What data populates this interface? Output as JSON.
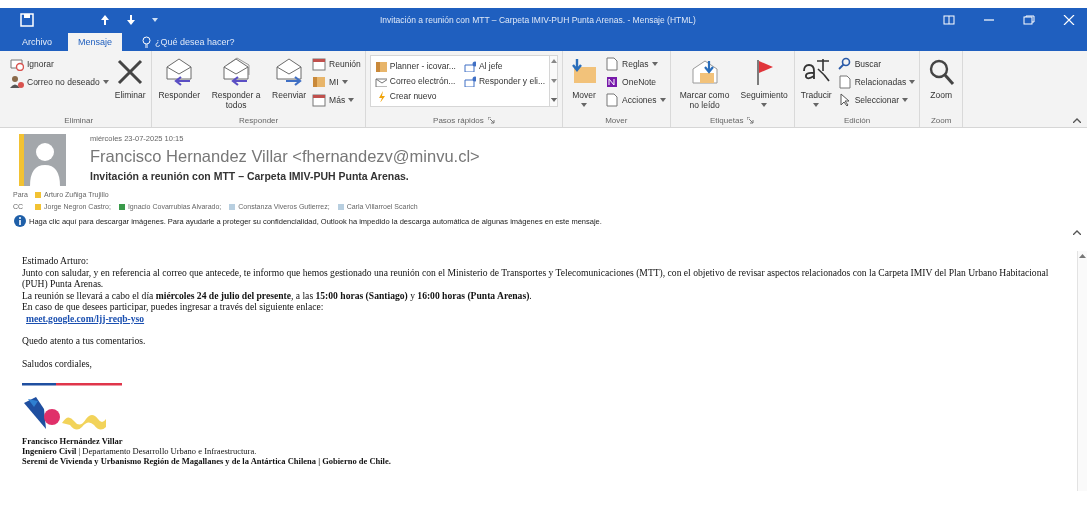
{
  "window": {
    "title": "Invitación a reunión con MTT – Carpeta IMIV-PUH Punta Arenas. - Mensaje (HTML)"
  },
  "tabs": [
    {
      "label": "Archivo",
      "selected": false
    },
    {
      "label": "Mensaje",
      "selected": true
    }
  ],
  "tell_me": {
    "placeholder": "¿Qué desea hacer?"
  },
  "ribbon": [
    {
      "label": "Eliminar",
      "launcher": false,
      "items": [
        {
          "kind": "small",
          "label": "Ignorar",
          "caret": false
        },
        {
          "kind": "small",
          "label": "Correo no deseado",
          "caret": true
        },
        {
          "kind": "large",
          "label": "Eliminar",
          "caret": false
        }
      ]
    },
    {
      "label": "Responder",
      "launcher": false,
      "items": [
        {
          "kind": "large",
          "label": "Responder",
          "caret": false
        },
        {
          "kind": "large",
          "label": "Responder a todos",
          "caret": false
        },
        {
          "kind": "large",
          "label": "Reenviar",
          "caret": false
        },
        {
          "kind": "small",
          "label": "Reunión",
          "caret": false
        },
        {
          "kind": "small",
          "label": "MI",
          "caret": true
        },
        {
          "kind": "small",
          "label": "Más",
          "caret": true
        }
      ]
    },
    {
      "label": "Pasos rápidos",
      "launcher": true,
      "items": [
        {
          "kind": "gallery",
          "label": "Planner - icovar..."
        },
        {
          "kind": "gallery",
          "label": "Correo electrón..."
        },
        {
          "kind": "gallery",
          "label": "Crear nuevo"
        },
        {
          "kind": "gallery",
          "label": "Al jefe"
        },
        {
          "kind": "gallery",
          "label": "Responder y eli..."
        }
      ]
    },
    {
      "label": "Mover",
      "launcher": false,
      "items": [
        {
          "kind": "large",
          "label": "Mover",
          "caret": true
        },
        {
          "kind": "small",
          "label": "Reglas",
          "caret": true
        },
        {
          "kind": "small",
          "label": "OneNote",
          "caret": false
        },
        {
          "kind": "small",
          "label": "Acciones",
          "caret": true
        }
      ]
    },
    {
      "label": "Etiquetas",
      "launcher": true,
      "items": [
        {
          "kind": "large",
          "label": "Marcar como no leído",
          "caret": false
        },
        {
          "kind": "large",
          "label": "Seguimiento",
          "caret": true
        }
      ]
    },
    {
      "label": "Edición",
      "launcher": false,
      "items": [
        {
          "kind": "large",
          "label": "Traducir",
          "caret": true
        },
        {
          "kind": "small",
          "label": "Buscar",
          "caret": false
        },
        {
          "kind": "small",
          "label": "Relacionadas",
          "caret": true
        },
        {
          "kind": "small",
          "label": "Seleccionar",
          "caret": true
        }
      ]
    },
    {
      "label": "Zoom",
      "launcher": false,
      "items": [
        {
          "kind": "large",
          "label": "Zoom",
          "caret": false
        }
      ]
    }
  ],
  "message": {
    "date": "miércoles 23-07-2025 10:15",
    "sender": "Francisco Hernandez Villar <fhernandezv@minvu.cl>",
    "subject": "Invitación a reunión con MTT – Carpeta IMIV-PUH Punta Arenas.",
    "to": {
      "label": "Para",
      "recipients": [
        {
          "name": "Arturo Zuñiga Trujillo",
          "color": "#f2c232"
        }
      ]
    },
    "cc": {
      "label": "CC",
      "recipients": [
        {
          "name": "Jorge Negron Castro;",
          "color": "#f2c232"
        },
        {
          "name": "Ignacio Covarrubias Alvarado;",
          "color": "#3a9a4a"
        },
        {
          "name": "Constanza Viveros Gutierrez;",
          "color": "#b8cfe0"
        },
        {
          "name": "Carla Villarroel Scarich",
          "color": "#b8cfe0"
        }
      ]
    },
    "info_bar": "Haga clic aquí para descargar imágenes. Para ayudarle a proteger su confidencialidad, Outlook ha impedido la descarga automática de algunas imágenes en este mensaje."
  },
  "body": [
    {
      "kind": "text",
      "text": "Estimado Arturo:"
    },
    {
      "kind": "text",
      "text": "Junto con saludar, y en referencia al correo que antecede, te informo que hemos gestionado una reunión con el Ministerio de Transportes y Telecomunicaciones (MTT), con el objetivo de revisar aspectos relacionados con la Carpeta IMIV del Plan Urbano Habitacional (PUH) Punta Arenas."
    },
    {
      "kind": "text",
      "text": "La reunión se llevará a cabo el día **miércoles 24 de julio del presente**, a las **15:00 horas (Santiago)** y **16:00 horas (Punta Arenas)**."
    },
    {
      "kind": "text",
      "text": "En caso de que desees participar, puedes ingresar a través del siguiente enlace:"
    },
    {
      "kind": "link",
      "text": "meet.google.com/ljj-reqb-yso"
    },
    {
      "kind": "gap"
    },
    {
      "kind": "text",
      "text": "Quedo atento a tus comentarios."
    },
    {
      "kind": "gap"
    },
    {
      "kind": "text",
      "text": "Saludos cordiales,"
    }
  ],
  "signature": [
    "**Francisco Hernández Villar**",
    "**Ingeniero Civil** | Departamento Desarrollo Urbano e Infraestructura.",
    "**Seremi de Vivienda y Urbanismo Región de Magallanes y de la Antártica Chilena | Gobierno de Chile.**"
  ]
}
